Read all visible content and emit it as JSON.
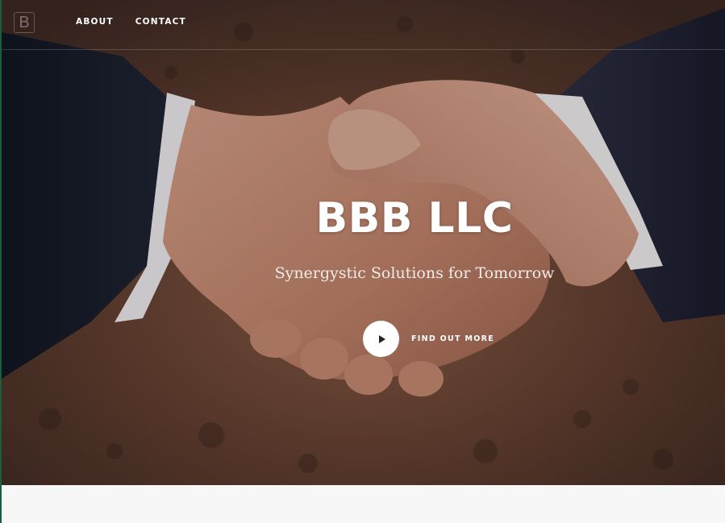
{
  "brand": {
    "logo_letter": "B"
  },
  "nav": {
    "links": [
      {
        "label": "ABOUT"
      },
      {
        "label": "CONTACT"
      }
    ]
  },
  "hero": {
    "title": "BBB LLC",
    "subtitle": "Synergystic Solutions for Tomorrow",
    "cta_label": "FIND OUT MORE",
    "background_image": "handshake-photo"
  },
  "colors": {
    "text_primary": "#ffffff",
    "below_section_bg": "#f7f7f7",
    "cta_circle": "#ffffff"
  },
  "icons": {
    "cta_icon": "play-icon"
  }
}
